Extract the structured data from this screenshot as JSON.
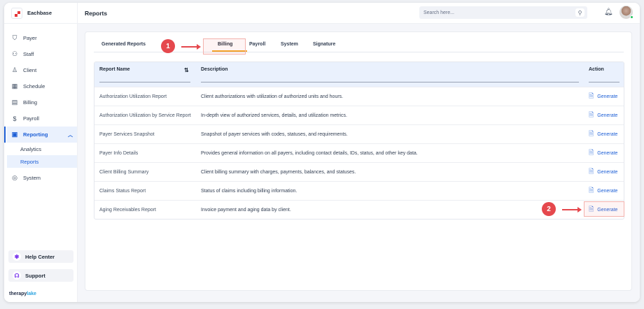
{
  "app": {
    "name": "Eachbase",
    "footer_brand_a": "therapy",
    "footer_brand_b": "lake"
  },
  "sidebar": {
    "items": [
      {
        "label": "Payer",
        "icon": "shield-icon"
      },
      {
        "label": "Staff",
        "icon": "users-icon"
      },
      {
        "label": "Client",
        "icon": "user-icon"
      },
      {
        "label": "Schedule",
        "icon": "calendar-icon"
      },
      {
        "label": "Billing",
        "icon": "receipt-icon"
      },
      {
        "label": "Payroll",
        "icon": "money-icon"
      },
      {
        "label": "Reporting",
        "icon": "clipboard-icon",
        "expanded": true
      },
      {
        "label": "System",
        "icon": "gear-icon"
      }
    ],
    "sub_items": [
      {
        "label": "Analytics"
      },
      {
        "label": "Reports",
        "active": true
      }
    ],
    "help_center": "Help Center",
    "support": "Support"
  },
  "header": {
    "title": "Reports",
    "search_placeholder": "Search here..."
  },
  "tabs": [
    {
      "label": "Generated Reports"
    },
    {
      "label": "Billing",
      "active": true
    },
    {
      "label": "Payroll"
    },
    {
      "label": "System"
    },
    {
      "label": "Signature"
    }
  ],
  "annotations": [
    "1",
    "2"
  ],
  "table": {
    "headers": {
      "name": "Report Name",
      "description": "Description",
      "action": "Action"
    },
    "action_label": "Generate",
    "rows": [
      {
        "name": "Authorization Utilization Report",
        "description": "Client authorizations with utilization of authorized units and hours."
      },
      {
        "name": "Authorization Utilization by Service Report",
        "description": "In-depth view of authorized services, details, and utilization metrics."
      },
      {
        "name": "Payer Services Snapshot",
        "description": "Snapshot of payer services with codes, statuses, and requirements."
      },
      {
        "name": "Payer Info Details",
        "description": "Provides general information on all payers, including contact details, IDs, status, and other key data."
      },
      {
        "name": "Client Billing Summary",
        "description": "Client billing summary with charges, payments, balances, and statuses."
      },
      {
        "name": "Claims Status Report",
        "description": "Status of claims including billing information."
      },
      {
        "name": "Aging Receivables Report",
        "description": "Invoice payment and aging data by client."
      }
    ]
  },
  "colors": {
    "accent": "#1d5fd6",
    "tab_underline": "#f5a623",
    "annotation": "#e5484d"
  }
}
